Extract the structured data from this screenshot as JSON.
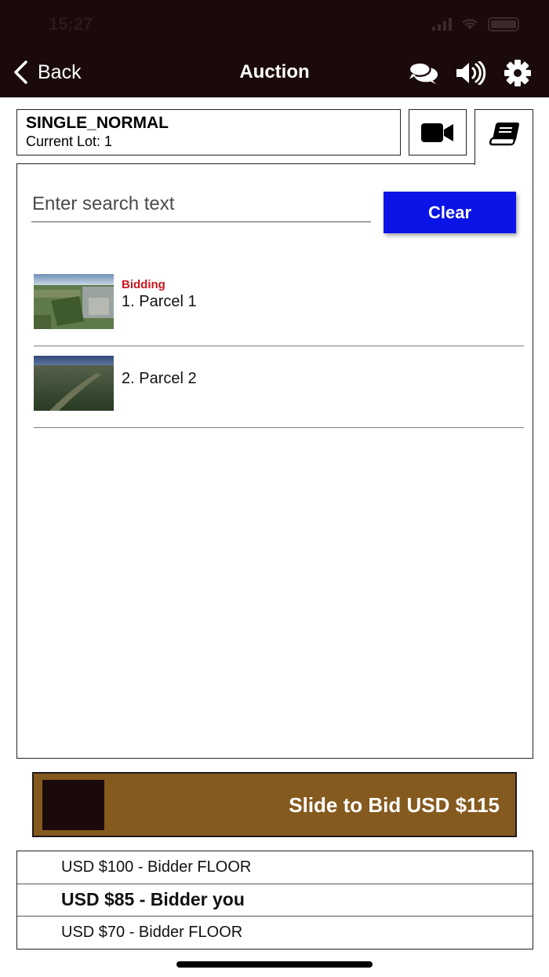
{
  "status_bar": {
    "time": "15:27"
  },
  "nav": {
    "back_label": "Back",
    "title": "Auction",
    "icons": [
      "chat-bubbles-icon",
      "speaker-icon",
      "gear-icon"
    ]
  },
  "lot_header": {
    "name": "SINGLE_NORMAL",
    "current_lot": "Current Lot: 1"
  },
  "tabs": [
    "video-camera-icon",
    "catalog-book-icon"
  ],
  "search": {
    "placeholder": "Enter search text",
    "value": "",
    "clear_label": "Clear"
  },
  "lots": [
    {
      "status": "Bidding",
      "title": "1. Parcel 1"
    },
    {
      "status": "",
      "title": "2. Parcel 2"
    }
  ],
  "slider": {
    "label": "Slide to Bid USD $115"
  },
  "bids": [
    {
      "text": "USD $100 - Bidder FLOOR",
      "bold": false
    },
    {
      "text": "USD $85 - Bidder you",
      "bold": true
    },
    {
      "text": "USD $70 - Bidder FLOOR",
      "bold": false
    }
  ],
  "colors": {
    "header_bg": "#1b0a0c",
    "clear_button": "#0a14e6",
    "slider_bg": "#855a1f",
    "bidding_status": "#c8161d"
  }
}
